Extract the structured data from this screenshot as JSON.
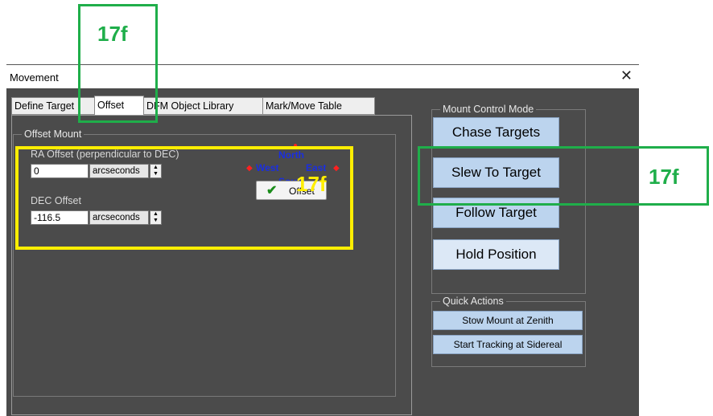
{
  "window": {
    "title": "Movement",
    "close_glyph": "✕"
  },
  "tabs": [
    {
      "label": "Define Target",
      "active": false
    },
    {
      "label": "Offset",
      "active": true
    },
    {
      "label": "DFM Object Library",
      "active": false
    },
    {
      "label": "Mark/Move Table",
      "active": false
    }
  ],
  "offset_mount": {
    "group_title": "Offset Mount",
    "ra": {
      "label": "RA Offset (perpendicular to DEC)",
      "value": "0",
      "unit": "arcseconds"
    },
    "dec": {
      "label": "DEC Offset",
      "value": "-116.5",
      "unit": "arcseconds"
    },
    "compass": {
      "north": "North",
      "south": "South",
      "east": "East",
      "west": "West"
    },
    "offset_button": "Offset"
  },
  "mount_control": {
    "group_title": "Mount Control Mode",
    "buttons": [
      "Chase Targets",
      "Slew To Target",
      "Follow Target",
      "Hold Position"
    ]
  },
  "quick_actions": {
    "group_title": "Quick Actions",
    "buttons": [
      "Stow Mount at Zenith",
      "Start Tracking at Sidereal"
    ]
  },
  "annotations": {
    "top_label": "17f",
    "right_label": "17f",
    "center_label": "17f",
    "green_color": "#1fae4a",
    "yellow_color": "#ffee00"
  },
  "icons": {
    "close": "close-icon",
    "check": "check-icon",
    "spin_up": "arrow-up-icon",
    "spin_down": "arrow-down-icon"
  }
}
